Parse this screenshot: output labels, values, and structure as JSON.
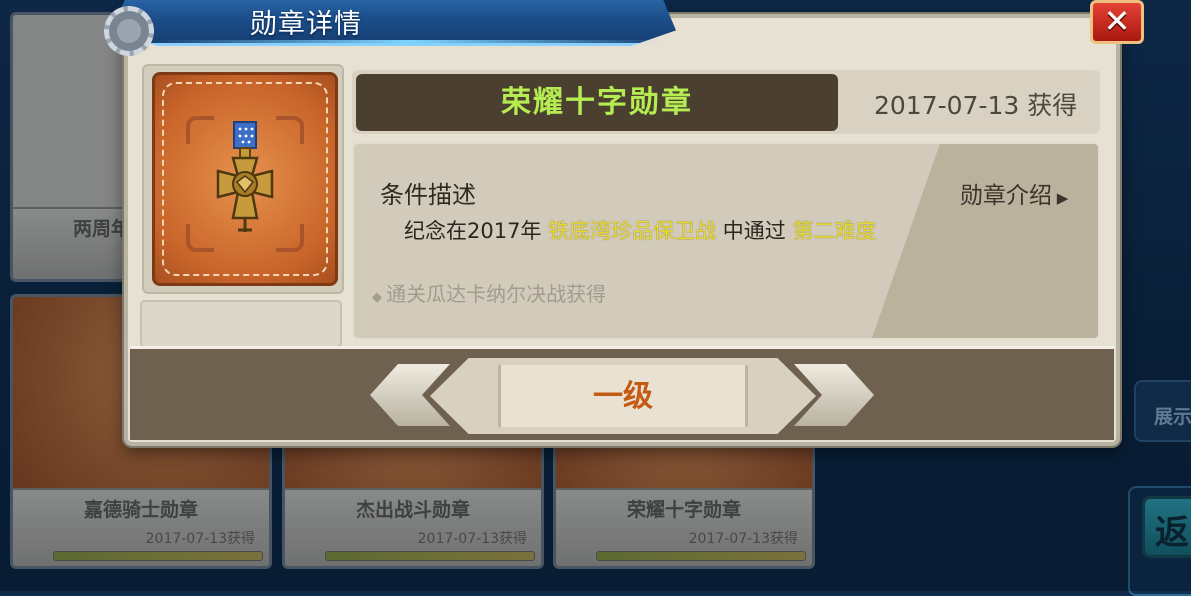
{
  "dialog": {
    "title": "勋章详情",
    "close_label": "✕"
  },
  "medal": {
    "name": "荣耀十字勋章",
    "date": "2017-07-13 获得",
    "condition_label": "条件描述",
    "intro_link": "勋章介绍",
    "description_prefix": "纪念在2017年 ",
    "description_event": "铁底湾珍品保卫战",
    "description_middle": " 中通过 ",
    "description_difficulty": "第二难度",
    "hint": "通关瓜达卡纳尔决战获得",
    "icon": "cross-medal-icon"
  },
  "level": {
    "current": "一级"
  },
  "background_cards": [
    {
      "name": "两周年",
      "date": ""
    },
    {
      "name": "嘉德骑士勋章",
      "date": "2017-07-13获得"
    },
    {
      "name": "杰出战斗勋章",
      "date": "2017-07-13获得"
    },
    {
      "name": "荣耀十字勋章",
      "date": "2017-07-13获得"
    }
  ],
  "side": {
    "show_label": "展示",
    "back_label": "返"
  },
  "colors": {
    "name_text": "#b4ec52",
    "highlight": "#e6d934",
    "level_text": "#c45a13",
    "title_tab": "#1b4d8a"
  }
}
